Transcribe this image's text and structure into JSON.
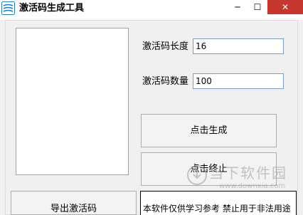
{
  "window": {
    "title": "激活码生成工具",
    "minimize_glyph": "─",
    "maximize_glyph": "☐",
    "close_glyph": "✕",
    "close_color": "#c7372f"
  },
  "form": {
    "length_label": "激活码长度",
    "length_value": "16",
    "count_label": "激活码数量",
    "count_value": "100"
  },
  "buttons": {
    "generate_label": "点击生成",
    "stop_label": "点击终止",
    "export_label": "导出激活码"
  },
  "notice": {
    "text": "本软件仅供学习参考  禁止用于非法用途"
  },
  "watermark": {
    "text": "当下软件园",
    "sub": "www.downxia.com"
  },
  "icons": {
    "app": "app-logo-icon",
    "watermark": "downxia-logo-icon"
  }
}
